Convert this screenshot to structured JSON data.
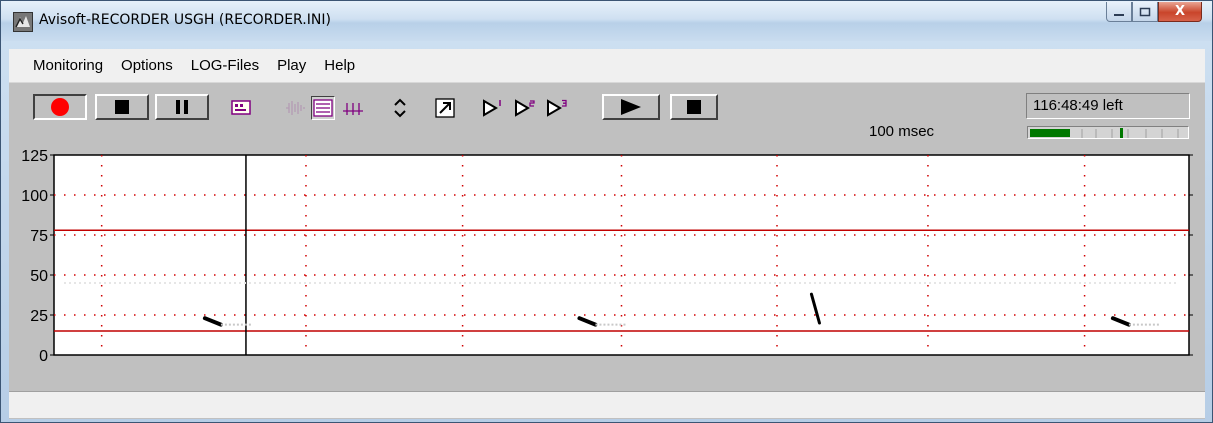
{
  "window": {
    "title": "Avisoft-RECORDER USGH  (RECORDER.INI)",
    "controls": {
      "minimize": "–",
      "maximize": "□",
      "close": "X"
    }
  },
  "menu": {
    "items": [
      "Monitoring",
      "Options",
      "LOG-Files",
      "Play",
      "Help"
    ]
  },
  "toolbar": {
    "buttons": [
      {
        "name": "record",
        "icon": "record-circle-red"
      },
      {
        "name": "stop",
        "icon": "stop-square"
      },
      {
        "name": "pause",
        "icon": "pause-bars"
      },
      {
        "name": "display-mode",
        "icon": "monitor-icon"
      },
      {
        "name": "waveform",
        "icon": "waveform-icon"
      },
      {
        "name": "spectrogram",
        "icon": "spectrogram-icon"
      },
      {
        "name": "trigger-level",
        "icon": "trigger-icon"
      },
      {
        "name": "scale-updown",
        "icon": "updown-arrows-icon"
      },
      {
        "name": "open-external",
        "icon": "arrow-out-icon"
      },
      {
        "name": "play-1",
        "icon": "play-outline-1"
      },
      {
        "name": "play-2",
        "icon": "play-outline-2"
      },
      {
        "name": "play-3",
        "icon": "play-outline-3"
      },
      {
        "name": "play",
        "icon": "play-solid"
      },
      {
        "name": "play-stop",
        "icon": "stop-square"
      }
    ],
    "remaining_time": "116:48:49 left",
    "time_resolution": "100 msec",
    "level": 0.25,
    "peak": 0.58
  },
  "spectrogram": {
    "y_ticks": [
      "125",
      "100",
      "75",
      "50",
      "25",
      "0"
    ],
    "y_values": [
      125,
      100,
      75,
      50,
      25,
      0
    ],
    "upper_threshold": 78,
    "lower_threshold": 15,
    "cursor_fraction": 0.133,
    "calls": [
      {
        "t": 0.14,
        "f": 20,
        "kind": "flat"
      },
      {
        "t": 0.47,
        "f": 20,
        "kind": "flat"
      },
      {
        "t": 0.67,
        "f": 30,
        "kind": "sweep"
      },
      {
        "t": 0.94,
        "f": 20,
        "kind": "flat"
      }
    ],
    "colors": {
      "grid": "#d00000",
      "threshold": "#c00000",
      "signal": "#000000"
    }
  },
  "statusbar": {
    "text": ""
  }
}
